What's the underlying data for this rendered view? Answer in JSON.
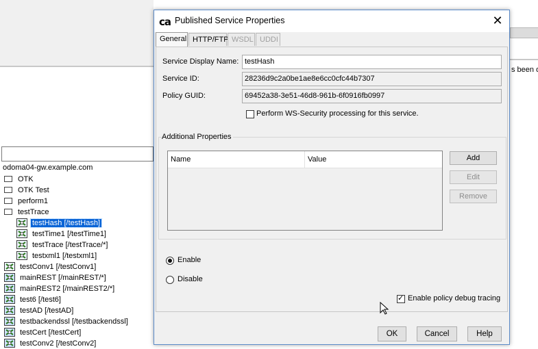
{
  "background": {
    "status_fragment": "s been d",
    "tree_root": "odoma04-gw.example.com",
    "tree": [
      {
        "label": "OTK",
        "kind": "folder",
        "indent": 0
      },
      {
        "label": "OTK Test",
        "kind": "folder",
        "indent": 0
      },
      {
        "label": "perform1",
        "kind": "folder",
        "indent": 0
      },
      {
        "label": "testTrace",
        "kind": "folder",
        "indent": 0
      },
      {
        "label": "testHash [/testHash]",
        "kind": "service",
        "indent": 1,
        "selected": true
      },
      {
        "label": "testTime1 [/testTime1]",
        "kind": "service",
        "indent": 1
      },
      {
        "label": "testTrace [/testTrace/*]",
        "kind": "service",
        "indent": 1
      },
      {
        "label": "testxml1 [/testxml1]",
        "kind": "service",
        "indent": 1
      },
      {
        "label": "testConv1 [/testConv1]",
        "kind": "service",
        "indent": 0
      },
      {
        "label": "mainREST [/mainREST/*]",
        "kind": "service2",
        "indent": 0
      },
      {
        "label": "mainREST2 [/mainREST2/*]",
        "kind": "service2",
        "indent": 0
      },
      {
        "label": "test6 [/test6]",
        "kind": "service2",
        "indent": 0
      },
      {
        "label": "testAD [/testAD]",
        "kind": "service2",
        "indent": 0
      },
      {
        "label": "testbackendssl [/testbackendssl]",
        "kind": "service2",
        "indent": 0
      },
      {
        "label": "testCert [/testCert]",
        "kind": "service2",
        "indent": 0
      },
      {
        "label": "testConv2 [/testConv2]",
        "kind": "service2",
        "indent": 0
      }
    ]
  },
  "dialog": {
    "logo": "ca",
    "title": "Published Service Properties",
    "close_glyph": "✕",
    "tabs": [
      "General",
      "HTTP/FTP",
      "WSDL",
      "UDDI"
    ],
    "service_display_name_label": "Service Display Name:",
    "service_display_name": "testHash",
    "service_id_label": "Service ID:",
    "service_id": "28236d9c2a0be1ae8e6cc0cfc44b7307",
    "policy_guid_label": "Policy GUID:",
    "policy_guid": "69452a38-3e51-46d8-961b-6f0916fb0997",
    "ws_security_label": "Perform WS-Security processing for this service.",
    "additional_properties_label": "Additional Properties",
    "columns": [
      "Name",
      "Value"
    ],
    "add_button": "Add",
    "edit_button": "Edit",
    "remove_button": "Remove",
    "enable_label": "Enable",
    "disable_label": "Disable",
    "debug_tracing_label": "Enable policy debug tracing",
    "ok_button": "OK",
    "cancel_button": "Cancel",
    "help_button": "Help"
  }
}
